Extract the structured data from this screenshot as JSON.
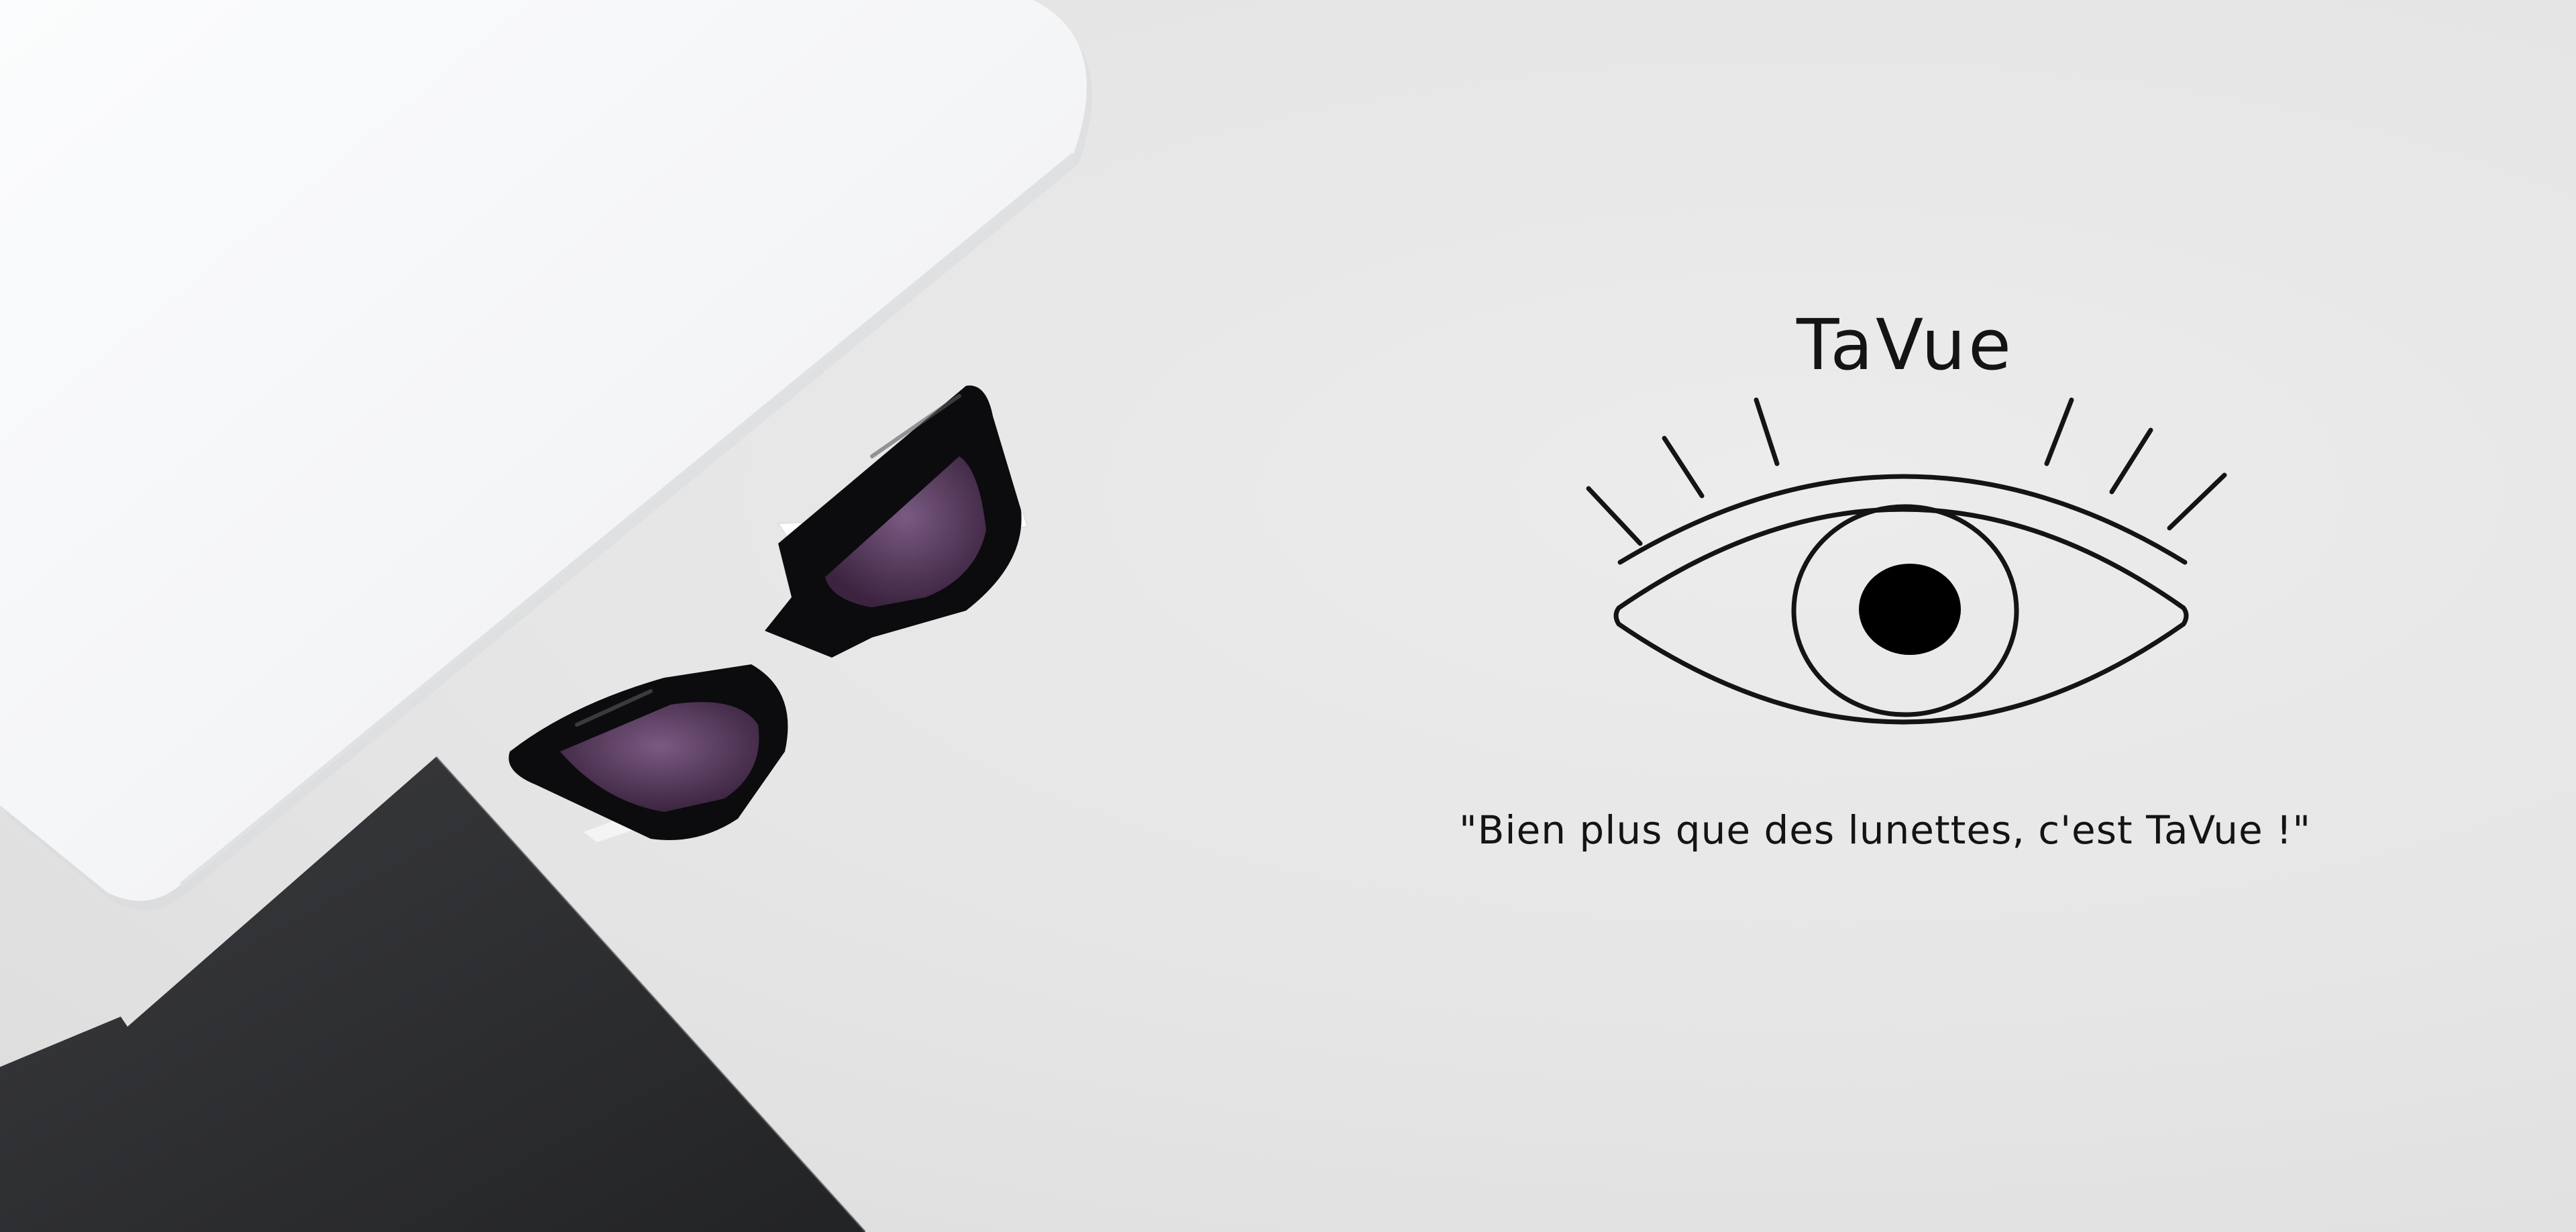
{
  "brand": {
    "name": "TaVue",
    "tagline": "\"Bien plus que des lunettes, c'est TaVue !\""
  },
  "colors": {
    "background": "#e4e4e4",
    "laptop": "#f6f7f8",
    "notebook": "#2b2c2e",
    "frame": "#0c0c0e",
    "lens": "#5a3a60",
    "ink": "#141414"
  },
  "logo": {
    "icon": "eye-with-lashes-icon"
  }
}
